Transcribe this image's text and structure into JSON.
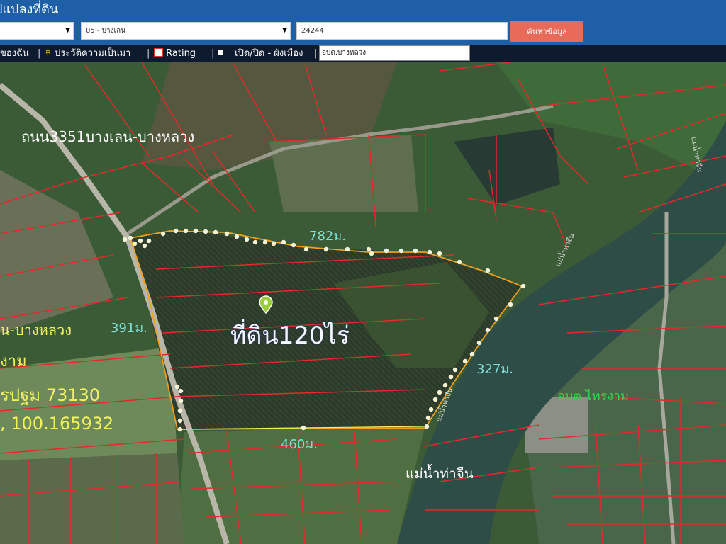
{
  "header": {
    "title": "ปแปลงที่ดิน",
    "district_value": "05 - บางเลน",
    "parcel_number_value": "24244",
    "search_button_label": "ค้นหาข้อมูล"
  },
  "toolbar": {
    "item_1": "ของฉัน",
    "item_2": "ประวัติความเป็นมา",
    "item_3": "Rating",
    "item_4": "เปิด/ปิด - ผังเมือง",
    "location_input_value": "อบต.บางหลวง"
  },
  "map": {
    "road_label": "ถนน3351บางเลน-บางหลวง",
    "parcel_label": "ที่ดิน120ไร่",
    "dim_top": "782ม.",
    "dim_left": "391ม.",
    "dim_right": "327ม.",
    "dim_bottom": "460ม.",
    "river_label": "แม่น้ำท่าจีน",
    "river_label_small_1": "แม่น้ำท่าจีน",
    "river_label_small_2": "แม่น้ำท่าจีน",
    "river_label_small_3": "แม่น้ำท่าจีน",
    "district_label": "อบต.ไทรงาม",
    "address_line_1": "น-บางหลวง",
    "address_line_2": "งาม",
    "address_line_3": "รปฐม 73130",
    "address_line_4": ", 100.165932"
  },
  "colors": {
    "header_bg": "#1f5fa6",
    "search_button": "#ea6a5a",
    "toolbar_bg": "#0e1a2e",
    "parcel_line": "#e02b2b",
    "boundary_line": "#f0a020",
    "annotation_yellow": "#f2f25c",
    "annotation_teal": "#7fe0d8",
    "annotation_green": "#39d14a"
  }
}
